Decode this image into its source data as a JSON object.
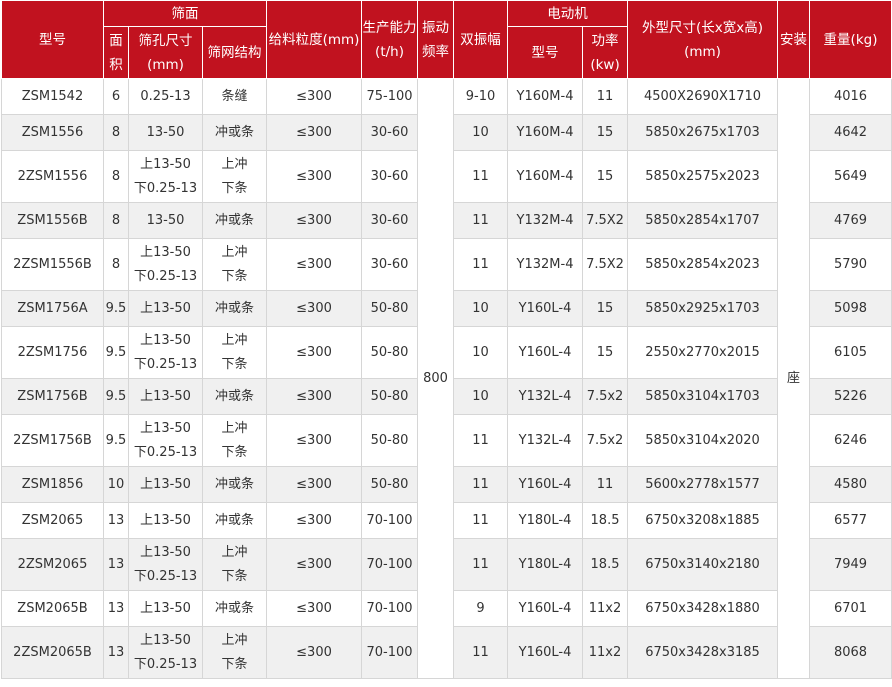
{
  "headers": {
    "model": "型号",
    "screen_surface": "筛面",
    "area": "面积",
    "aperture": "筛孔尺寸(mm)",
    "mesh_structure": "筛网结构",
    "feed_size": "给料粒度(mm)",
    "capacity": "生产能力(t/h)",
    "vibration_freq": "振动频率",
    "double_amplitude": "双振幅",
    "motor": "电动机",
    "motor_model": "型号",
    "power": "功率(kw)",
    "dimensions": "外型尺寸(长x宽x高)(mm)",
    "install": "安装",
    "weight": "重量(kg)"
  },
  "merged": {
    "vibration_freq": "800",
    "install": "座"
  },
  "rows": [
    {
      "model": "ZSM1542",
      "area": "6",
      "aperture": [
        "0.25-13"
      ],
      "mesh": [
        "条缝"
      ],
      "feed": "≤300",
      "capacity": "75-100",
      "amplitude": "9-10",
      "motor_model": "Y160M-4",
      "power": "11",
      "dims": "4500X2690X1710",
      "weight": "4016"
    },
    {
      "model": "ZSM1556",
      "area": "8",
      "aperture": [
        "13-50"
      ],
      "mesh": [
        "冲或条"
      ],
      "feed": "≤300",
      "capacity": "30-60",
      "amplitude": "10",
      "motor_model": "Y160M-4",
      "power": "15",
      "dims": "5850x2675x1703",
      "weight": "4642"
    },
    {
      "model": "2ZSM1556",
      "area": "8",
      "aperture": [
        "上13-50",
        "下0.25-13"
      ],
      "mesh": [
        "上冲",
        "下条"
      ],
      "feed": "≤300",
      "capacity": "30-60",
      "amplitude": "11",
      "motor_model": "Y160M-4",
      "power": "15",
      "dims": "5850x2575x2023",
      "weight": "5649"
    },
    {
      "model": "ZSM1556B",
      "area": "8",
      "aperture": [
        "13-50"
      ],
      "mesh": [
        "冲或条"
      ],
      "feed": "≤300",
      "capacity": "30-60",
      "amplitude": "11",
      "motor_model": "Y132M-4",
      "power": "7.5X2",
      "dims": "5850x2854x1707",
      "weight": "4769"
    },
    {
      "model": "2ZSM1556B",
      "area": "8",
      "aperture": [
        "上13-50",
        "下0.25-13"
      ],
      "mesh": [
        "上冲",
        "下条"
      ],
      "feed": "≤300",
      "capacity": "30-60",
      "amplitude": "11",
      "motor_model": "Y132M-4",
      "power": "7.5X2",
      "dims": "5850x2854x2023",
      "weight": "5790"
    },
    {
      "model": "ZSM1756A",
      "area": "9.5",
      "aperture": [
        "上13-50"
      ],
      "mesh": [
        "冲或条"
      ],
      "feed": "≤300",
      "capacity": "50-80",
      "amplitude": "10",
      "motor_model": "Y160L-4",
      "power": "15",
      "dims": "5850x2925x1703",
      "weight": "5098"
    },
    {
      "model": "2ZSM1756",
      "area": "9.5",
      "aperture": [
        "上13-50",
        "下0.25-13"
      ],
      "mesh": [
        "上冲",
        "下条"
      ],
      "feed": "≤300",
      "capacity": "50-80",
      "amplitude": "10",
      "motor_model": "Y160L-4",
      "power": "15",
      "dims": "2550x2770x2015",
      "weight": "6105"
    },
    {
      "model": "ZSM1756B",
      "area": "9.5",
      "aperture": [
        "上13-50"
      ],
      "mesh": [
        "冲或条"
      ],
      "feed": "≤300",
      "capacity": "50-80",
      "amplitude": "10",
      "motor_model": "Y132L-4",
      "power": "7.5x2",
      "dims": "5850x3104x1703",
      "weight": "5226"
    },
    {
      "model": "2ZSM1756B",
      "area": "9.5",
      "aperture": [
        "上13-50",
        "下0.25-13"
      ],
      "mesh": [
        "上冲",
        "下条"
      ],
      "feed": "≤300",
      "capacity": "50-80",
      "amplitude": "11",
      "motor_model": "Y132L-4",
      "power": "7.5x2",
      "dims": "5850x3104x2020",
      "weight": "6246"
    },
    {
      "model": "ZSM1856",
      "area": "10",
      "aperture": [
        "上13-50"
      ],
      "mesh": [
        "冲或条"
      ],
      "feed": "≤300",
      "capacity": "50-80",
      "amplitude": "11",
      "motor_model": "Y160L-4",
      "power": "11",
      "dims": "5600x2778x1577",
      "weight": "4580"
    },
    {
      "model": "ZSM2065",
      "area": "13",
      "aperture": [
        "上13-50"
      ],
      "mesh": [
        "冲或条"
      ],
      "feed": "≤300",
      "capacity": "70-100",
      "amplitude": "11",
      "motor_model": "Y180L-4",
      "power": "18.5",
      "dims": "6750x3208x1885",
      "weight": "6577"
    },
    {
      "model": "2ZSM2065",
      "area": "13",
      "aperture": [
        "上13-50",
        "下0.25-13"
      ],
      "mesh": [
        "上冲",
        "下条"
      ],
      "feed": "≤300",
      "capacity": "70-100",
      "amplitude": "11",
      "motor_model": "Y180L-4",
      "power": "18.5",
      "dims": "6750x3140x2180",
      "weight": "7949"
    },
    {
      "model": "ZSM2065B",
      "area": "13",
      "aperture": [
        "上13-50"
      ],
      "mesh": [
        "冲或条"
      ],
      "feed": "≤300",
      "capacity": "70-100",
      "amplitude": "9",
      "motor_model": "Y160L-4",
      "power": "11x2",
      "dims": "6750x3428x1880",
      "weight": "6701"
    },
    {
      "model": "2ZSM2065B",
      "area": "13",
      "aperture": [
        "上13-50",
        "下0.25-13"
      ],
      "mesh": [
        "上冲",
        "下条"
      ],
      "feed": "≤300",
      "capacity": "70-100",
      "amplitude": "11",
      "motor_model": "Y160L-4",
      "power": "11x2",
      "dims": "6750x3428x3185",
      "weight": "8068"
    }
  ]
}
